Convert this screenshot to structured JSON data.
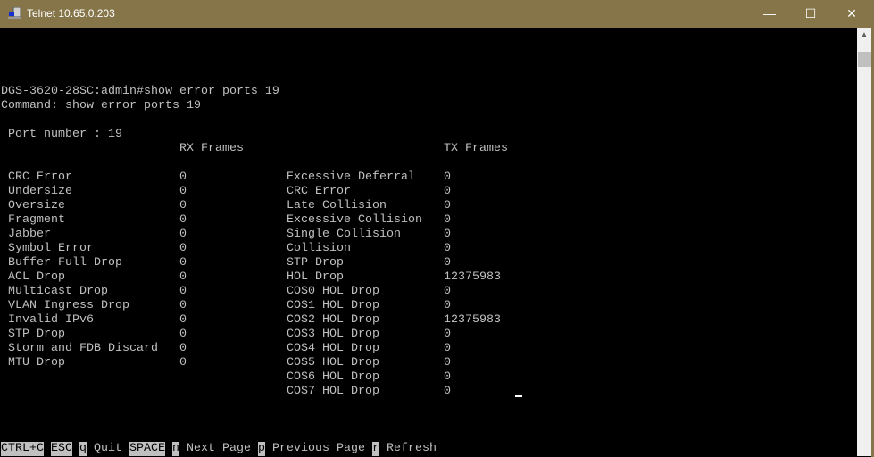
{
  "window": {
    "title": "Telnet 10.65.0.203",
    "minimize": "—",
    "maximize": "☐",
    "close": "✕"
  },
  "terminal": {
    "prompt_line": "DGS-3620-28SC:admin#show error ports 19",
    "command_line": "Command: show error ports 19",
    "port_line": " Port number : 19",
    "rx_header": "RX Frames",
    "rx_dashes": "---------",
    "tx_header": "TX Frames",
    "tx_dashes": "---------",
    "rx": [
      [
        "CRC Error",
        "0"
      ],
      [
        "Undersize",
        "0"
      ],
      [
        "Oversize",
        "0"
      ],
      [
        "Fragment",
        "0"
      ],
      [
        "Jabber",
        "0"
      ],
      [
        "Symbol Error",
        "0"
      ],
      [
        "Buffer Full Drop",
        "0"
      ],
      [
        "ACL Drop",
        "0"
      ],
      [
        "Multicast Drop",
        "0"
      ],
      [
        "VLAN Ingress Drop",
        "0"
      ],
      [
        "Invalid IPv6",
        "0"
      ],
      [
        "STP Drop",
        "0"
      ],
      [
        "Storm and FDB Discard",
        "0"
      ],
      [
        "MTU Drop",
        "0"
      ]
    ],
    "tx": [
      [
        "Excessive Deferral",
        "0"
      ],
      [
        "CRC Error",
        "0"
      ],
      [
        "Late Collision",
        "0"
      ],
      [
        "Excessive Collision",
        "0"
      ],
      [
        "Single Collision",
        "0"
      ],
      [
        "Collision",
        "0"
      ],
      [
        "STP Drop",
        "0"
      ],
      [
        "HOL Drop",
        "12375983"
      ],
      [
        "COS0 HOL Drop",
        "0"
      ],
      [
        "COS1 HOL Drop",
        "0"
      ],
      [
        "COS2 HOL Drop",
        "12375983"
      ],
      [
        "COS3 HOL Drop",
        "0"
      ],
      [
        "COS4 HOL Drop",
        "0"
      ],
      [
        "COS5 HOL Drop",
        "0"
      ],
      [
        "COS6 HOL Drop",
        "0"
      ],
      [
        "COS7 HOL Drop",
        "0"
      ]
    ]
  },
  "footer": [
    {
      "key": "CTRL+C",
      "label": ""
    },
    {
      "key": "ESC",
      "label": ""
    },
    {
      "key": "q",
      "label": "Quit"
    },
    {
      "key": "SPACE",
      "label": ""
    },
    {
      "key": "n",
      "label": "Next Page"
    },
    {
      "key": "p",
      "label": "Previous Page"
    },
    {
      "key": "r",
      "label": "Refresh"
    }
  ]
}
